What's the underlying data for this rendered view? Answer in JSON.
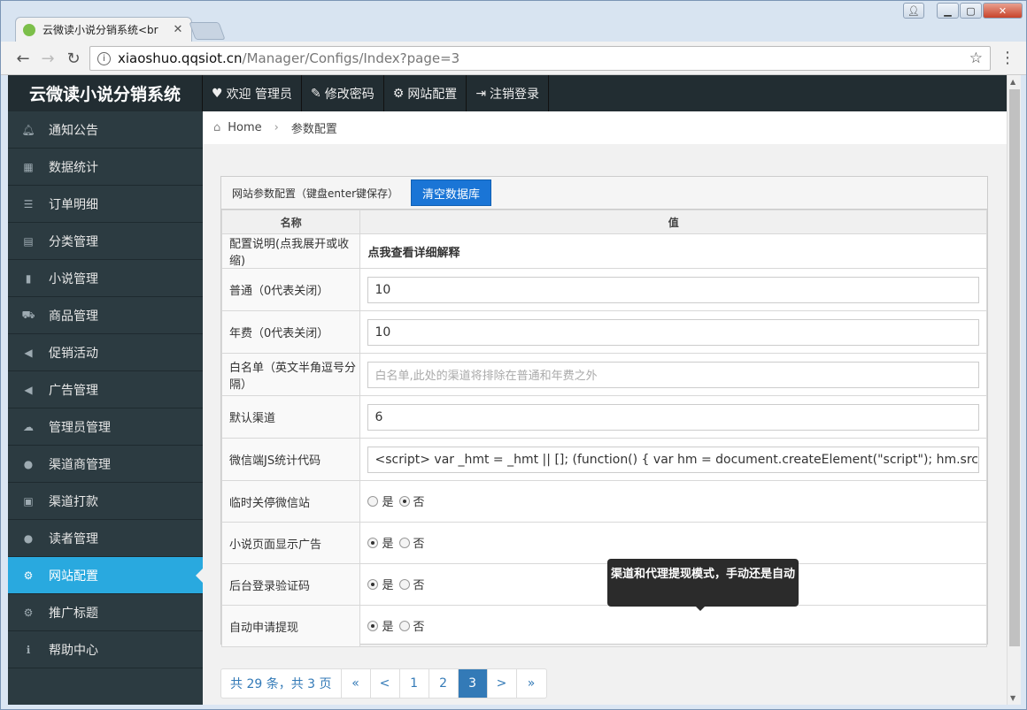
{
  "browser": {
    "tab_title": "云微读小说分销系统<br",
    "url_host": "xiaoshuo.qqsiot.cn",
    "url_path": "/Manager/Configs/Index?page=3"
  },
  "app": {
    "brand": "云微读小说分销系统",
    "topnav": [
      {
        "icon": "heart-icon",
        "glyph": "♥",
        "label": "欢迎 管理员"
      },
      {
        "icon": "edit-icon",
        "glyph": "✎",
        "label": "修改密码"
      },
      {
        "icon": "gear-icon",
        "glyph": "⚙",
        "label": "网站配置"
      },
      {
        "icon": "logout-icon",
        "glyph": "⇥",
        "label": "注销登录"
      }
    ]
  },
  "sidebar": {
    "items": [
      {
        "icon": "bell-icon",
        "glyph": "🔔︎",
        "label": "通知公告"
      },
      {
        "icon": "bar-chart-icon",
        "glyph": "▦",
        "label": "数据统计"
      },
      {
        "icon": "list-icon",
        "glyph": "☰",
        "label": "订单明细"
      },
      {
        "icon": "list-alt-icon",
        "glyph": "▤",
        "label": "分类管理"
      },
      {
        "icon": "book-icon",
        "glyph": "▮",
        "label": "小说管理"
      },
      {
        "icon": "truck-icon",
        "glyph": "⛟",
        "label": "商品管理"
      },
      {
        "icon": "bullhorn-icon",
        "glyph": "◀",
        "label": "促销活动"
      },
      {
        "icon": "bullhorn-icon",
        "glyph": "◀",
        "label": "广告管理"
      },
      {
        "icon": "cloud-icon",
        "glyph": "☁",
        "label": "管理员管理"
      },
      {
        "icon": "users-icon",
        "glyph": "●",
        "label": "渠道商管理"
      },
      {
        "icon": "money-icon",
        "glyph": "▣",
        "label": "渠道打款"
      },
      {
        "icon": "user-icon",
        "glyph": "●",
        "label": "读者管理"
      },
      {
        "icon": "gear-icon",
        "glyph": "⚙",
        "label": "网站配置"
      },
      {
        "icon": "gear-icon",
        "glyph": "⚙",
        "label": "推广标题"
      },
      {
        "icon": "info-icon",
        "glyph": "ℹ",
        "label": "帮助中心"
      }
    ],
    "active_index": 12
  },
  "breadcrumb": {
    "home": "Home",
    "current": "参数配置"
  },
  "panel": {
    "title": "网站参数配置（键盘enter键保存）",
    "clear_db_button": "清空数据库",
    "col_name": "名称",
    "col_value": "值",
    "desc_label": "配置说明(点我展开或收缩)",
    "desc_value": "点我查看详细解释",
    "fields": [
      {
        "label": "普通（0代表关闭）",
        "value": "10"
      },
      {
        "label": "年费（0代表关闭）",
        "value": "10"
      },
      {
        "label": "白名单（英文半角逗号分隔）",
        "placeholder": "白名单,此处的渠道将排除在普通和年费之外"
      },
      {
        "label": "默认渠道",
        "value": "6"
      },
      {
        "label": "微信端JS统计代码",
        "value": "<script> var _hmt = _hmt || []; (function() {   var hm = document.createElement(\"script\");   hm.src"
      }
    ],
    "radios": [
      {
        "label": "临时关停微信站",
        "selected": "否"
      },
      {
        "label": "小说页面显示广告",
        "selected": "是"
      },
      {
        "label": "后台登录验证码",
        "selected": "是"
      },
      {
        "label": "自动申请提现",
        "selected": "是"
      }
    ],
    "yes": "是",
    "no": "否"
  },
  "tooltip": "渠道和代理提现模式，手动还是自动",
  "pager": {
    "summary": "共 29 条，共 3 页",
    "first": "«",
    "prev": "<",
    "pages": [
      "1",
      "2",
      "3"
    ],
    "current": "3",
    "next": ">",
    "last": "»"
  }
}
